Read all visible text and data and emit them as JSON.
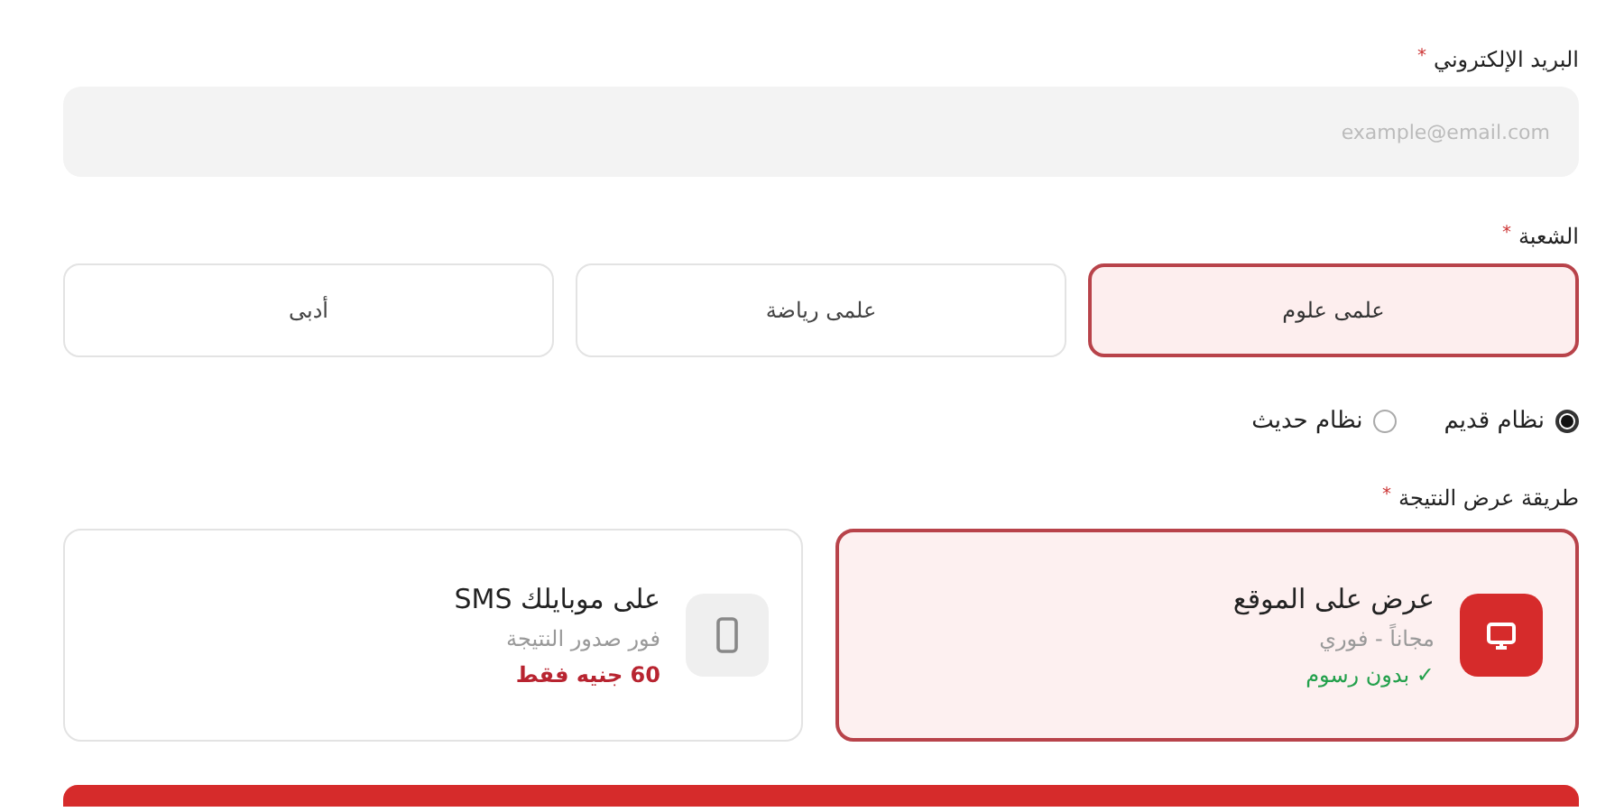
{
  "email": {
    "label": "البريد الإلكتروني",
    "required_mark": "*",
    "placeholder": "example@email.com"
  },
  "branch": {
    "label": "الشعبة",
    "required_mark": "*",
    "options": [
      {
        "label": "علمى علوم",
        "selected": true
      },
      {
        "label": "علمى رياضة",
        "selected": false
      },
      {
        "label": "أدبى",
        "selected": false
      }
    ]
  },
  "system": [
    {
      "label": "نظام قديم",
      "selected": true
    },
    {
      "label": "نظام حديث",
      "selected": false
    }
  ],
  "method": {
    "label": "طريقة عرض النتيجة",
    "required_mark": "*",
    "cards": [
      {
        "kind": "monitor",
        "title": "عرض على الموقع",
        "subtitle": "مجاناً - فوري",
        "note": {
          "kind": "free",
          "text": "✓ بدون رسوم"
        },
        "selected": true
      },
      {
        "kind": "phone",
        "title": "على موبايلك SMS",
        "subtitle": "فور صدور النتيجة",
        "note": {
          "kind": "price",
          "text": "60 جنيه فقط"
        },
        "selected": false
      }
    ]
  }
}
